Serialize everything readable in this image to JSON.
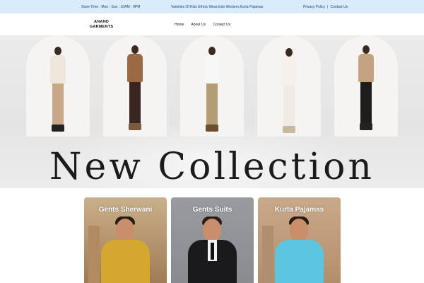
{
  "topbar": {
    "store_time": "Store Time : Mon - Sun : 10AM - 9PM",
    "variety": "Varieties Of Kids Ethnic Wear,Indo Western,Kurta Pajamas",
    "privacy": "Privacy Policy",
    "separator": "|",
    "contact": "Contact Us"
  },
  "navbar": {
    "logo_line1": "ANAND",
    "logo_line2": "GARMENTS",
    "items": [
      "Home",
      "About Us",
      "Contact Us"
    ]
  },
  "hero": {
    "title": "New Collection"
  },
  "cards": [
    {
      "label": "Gents Sherwani"
    },
    {
      "label": "Gents Suits"
    },
    {
      "label": "Kurta Pajamas"
    }
  ],
  "colors": {
    "topbar_bg": "#d8ecfb",
    "topbar_text": "#1f3f73",
    "hero_bg": "#e8e8e8"
  }
}
